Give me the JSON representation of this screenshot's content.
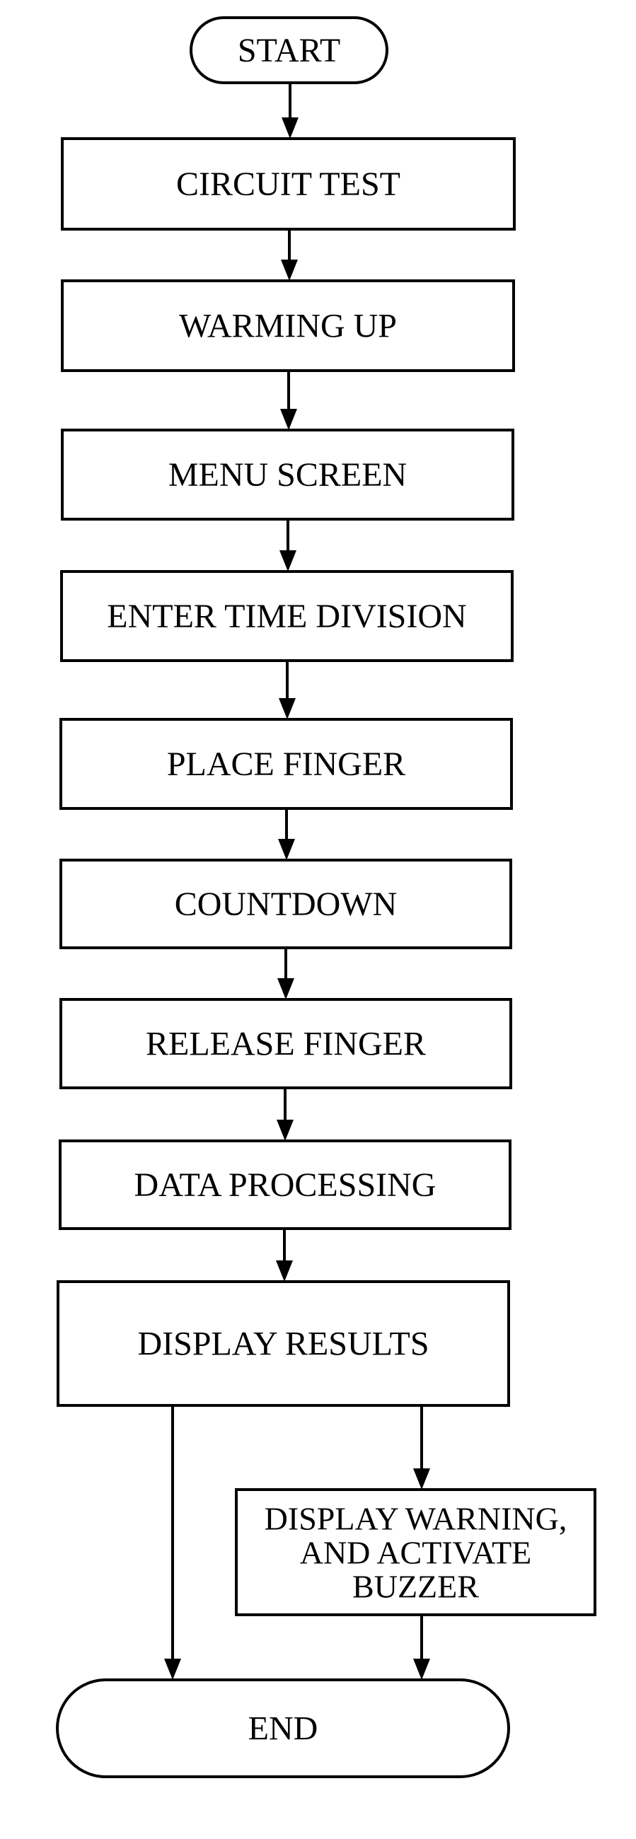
{
  "flowchart": {
    "nodes": [
      {
        "id": "start",
        "type": "terminal",
        "lines": [
          "START"
        ]
      },
      {
        "id": "circuit-test",
        "type": "process",
        "lines": [
          "CIRCUIT TEST"
        ]
      },
      {
        "id": "warming-up",
        "type": "process",
        "lines": [
          "WARMING UP"
        ]
      },
      {
        "id": "menu-screen",
        "type": "process",
        "lines": [
          "MENU SCREEN"
        ]
      },
      {
        "id": "enter-time-division",
        "type": "process",
        "lines": [
          "ENTER TIME DIVISION"
        ]
      },
      {
        "id": "place-finger",
        "type": "process",
        "lines": [
          "PLACE FINGER"
        ]
      },
      {
        "id": "countdown",
        "type": "process",
        "lines": [
          "COUNTDOWN"
        ]
      },
      {
        "id": "release-finger",
        "type": "process",
        "lines": [
          "RELEASE FINGER"
        ]
      },
      {
        "id": "data-processing",
        "type": "process",
        "lines": [
          "DATA PROCESSING"
        ]
      },
      {
        "id": "display-results",
        "type": "process",
        "lines": [
          "DISPLAY RESULTS"
        ]
      },
      {
        "id": "display-warning",
        "type": "process",
        "lines": [
          "DISPLAY WARNING,",
          "AND ACTIVATE",
          "BUZZER"
        ]
      },
      {
        "id": "end",
        "type": "terminal",
        "lines": [
          "END"
        ]
      }
    ],
    "edges": [
      {
        "from": "start",
        "to": "circuit-test"
      },
      {
        "from": "circuit-test",
        "to": "warming-up"
      },
      {
        "from": "warming-up",
        "to": "menu-screen"
      },
      {
        "from": "menu-screen",
        "to": "enter-time-division"
      },
      {
        "from": "enter-time-division",
        "to": "place-finger"
      },
      {
        "from": "place-finger",
        "to": "countdown"
      },
      {
        "from": "countdown",
        "to": "release-finger"
      },
      {
        "from": "release-finger",
        "to": "data-processing"
      },
      {
        "from": "data-processing",
        "to": "display-results"
      },
      {
        "from": "display-results",
        "to": "end"
      },
      {
        "from": "display-results",
        "to": "display-warning"
      },
      {
        "from": "display-warning",
        "to": "end"
      }
    ]
  }
}
